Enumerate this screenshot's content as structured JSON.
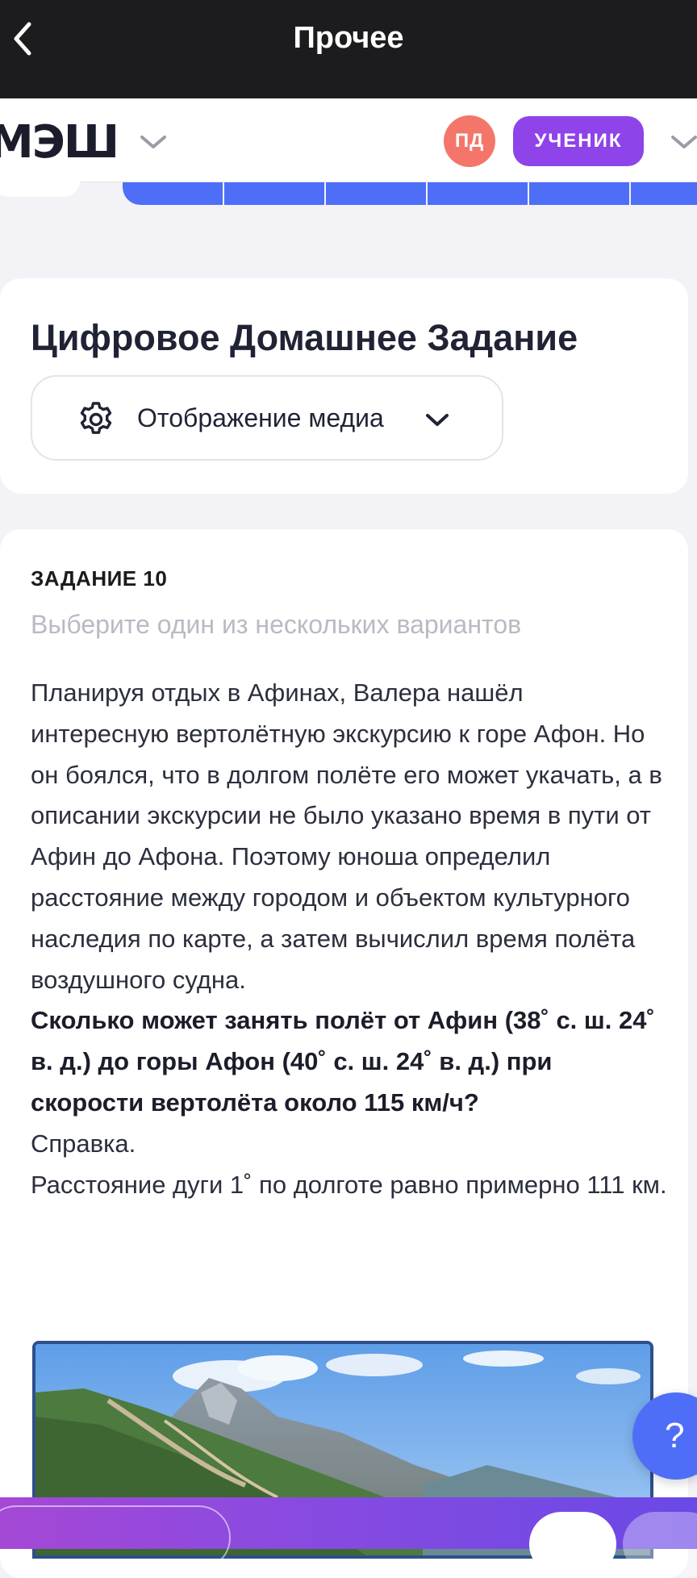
{
  "topbar": {
    "title": "Прочее",
    "back_icon": "chevron-left-icon"
  },
  "header": {
    "logo_text": "МЭШ",
    "avatar_initials": "ПД",
    "role_label": "УЧЕНИК",
    "colors": {
      "avatar_bg": "#f4766b",
      "role_bg": "#8e44e8",
      "accent_blue": "#4f6ef7"
    }
  },
  "cdz": {
    "title": "Цифровое Домашнее Задание",
    "media_button_label": "Отображение медиа",
    "media_icon": "gear-icon"
  },
  "task": {
    "number_label": "ЗАДАНИЕ 10",
    "hint": "Выберите один из нескольких вариантов",
    "paragraph": "Планируя отдых в Афинах, Валера нашёл интересную вертолётную экскурсию к горе Афон. Но он боялся, что в долгом полёте его может укачать, а в описании экскурсии не было указано время в пути от Афин до Афона. Поэтому юноша определил расстояние между городом и объектом культурного наследия по карте, а затем вычислил время полёта воздушного судна.",
    "question": "Сколько может занять полёт от Афин (38˚ с. ш. 24˚ в. д.) до горы Афон (40˚ с. ш. 24˚ в. д.) при скорости вертолёта около 115 км/ч?",
    "reference_title": "Справка.",
    "reference_text": "Расстояние дуги 1˚ по долготе равно примерно 111 км.",
    "image_subject": "mountain-photo"
  },
  "help": {
    "label": "?"
  }
}
